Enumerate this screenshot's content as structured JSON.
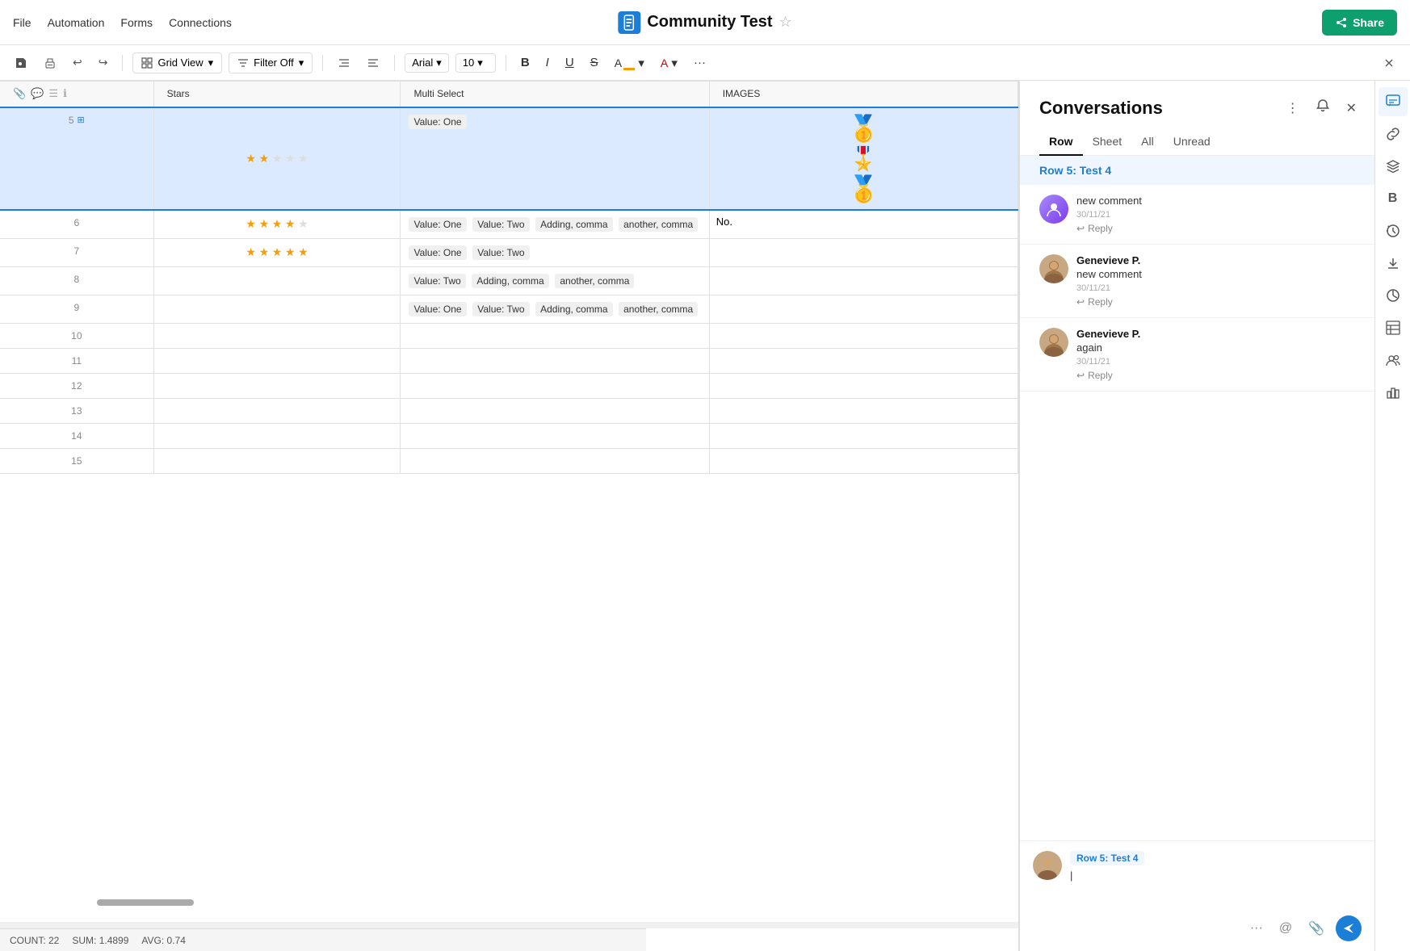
{
  "app": {
    "title": "Community Test",
    "menus": [
      "File",
      "Automation",
      "Forms",
      "Connections"
    ],
    "share_label": "Share"
  },
  "toolbar": {
    "view_label": "Grid View",
    "filter_label": "Filter Off",
    "font_label": "Arial",
    "font_size": "10",
    "bold": "B",
    "italic": "I",
    "underline": "U",
    "strikethrough": "S"
  },
  "table": {
    "columns": [
      "Stars",
      "Multi Select",
      "IMAGES"
    ],
    "status_bar": {
      "count": "COUNT: 22",
      "sum": "SUM: 1.4899",
      "avg": "AVG: 0.74"
    },
    "rows": [
      {
        "num": "5",
        "stars": 2,
        "multi": [
          "Value: One"
        ],
        "images": "🥇🎖️🥇",
        "selected": true
      },
      {
        "num": "6",
        "stars": 4,
        "multi": [
          "Value: One",
          "Value: Two",
          "Adding, comma",
          "another, comma"
        ],
        "images": "No."
      },
      {
        "num": "7",
        "stars": 5,
        "multi": [
          "Value: One",
          "Value: Two"
        ],
        "images": ""
      },
      {
        "num": "8",
        "stars": 0,
        "multi": [
          "Value: Two",
          "Adding, comma",
          "another, comma"
        ],
        "images": ""
      },
      {
        "num": "9",
        "stars": 0,
        "multi": [
          "Value: One",
          "Value: Two",
          "Adding, comma",
          "another, comma"
        ],
        "images": ""
      },
      {
        "num": "10",
        "stars": 0,
        "multi": [],
        "images": ""
      },
      {
        "num": "11",
        "stars": 0,
        "multi": [],
        "images": ""
      },
      {
        "num": "12",
        "stars": 0,
        "multi": [],
        "images": ""
      },
      {
        "num": "13",
        "stars": 0,
        "multi": [],
        "images": ""
      },
      {
        "num": "14",
        "stars": 0,
        "multi": [],
        "images": ""
      },
      {
        "num": "15",
        "stars": 0,
        "multi": [],
        "images": ""
      }
    ]
  },
  "conversations": {
    "title": "Conversations",
    "tabs": [
      "Row",
      "Sheet",
      "All",
      "Unread"
    ],
    "active_tab": "Row",
    "row_header": "Row 5: Test 4",
    "comments": [
      {
        "id": 1,
        "author": "",
        "avatar_type": "placeholder",
        "avatar_initials": "",
        "comment": "new comment",
        "date": "30/11/21",
        "reply_label": "Reply"
      },
      {
        "id": 2,
        "author": "Genevieve P.",
        "avatar_type": "photo",
        "comment": "new comment",
        "date": "30/11/21",
        "reply_label": "Reply"
      },
      {
        "id": 3,
        "author": "Genevieve P.",
        "avatar_type": "photo",
        "comment": "again",
        "date": "30/11/21",
        "reply_label": "Reply"
      }
    ],
    "input": {
      "row_badge": "Row 5: Test 4",
      "placeholder": "\\",
      "actions": {
        "more": "···",
        "mention": "@",
        "attach": "📎",
        "send": "➤"
      }
    }
  },
  "right_sidebar": {
    "icons": [
      "comments",
      "link",
      "layers",
      "B",
      "history",
      "download",
      "chart",
      "table",
      "users",
      "bar-chart"
    ]
  }
}
